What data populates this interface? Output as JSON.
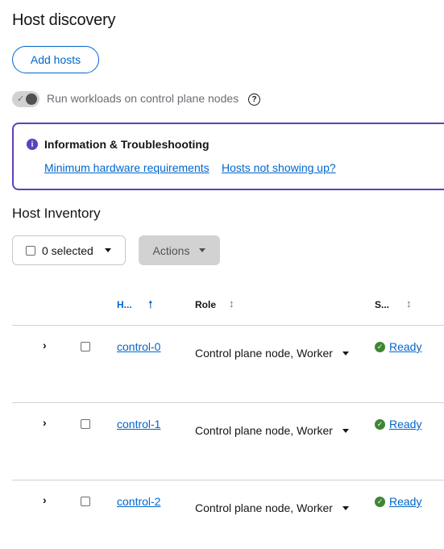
{
  "page": {
    "title": "Host discovery"
  },
  "toolbar": {
    "add_hosts_label": "Add hosts"
  },
  "workloads_toggle": {
    "label": "Run workloads on control plane nodes",
    "help_glyph": "?",
    "check_glyph": "✓"
  },
  "alert": {
    "icon_glyph": "i",
    "title": "Information & Troubleshooting",
    "links": [
      "Minimum hardware requirements",
      "Hosts not showing up?"
    ]
  },
  "inventory": {
    "title": "Host Inventory",
    "bulk_select_label": "0 selected",
    "actions_label": "Actions",
    "columns": {
      "hostname": "H...",
      "role": "Role",
      "status": "S..."
    },
    "sort_glyphs": {
      "active": "🠕",
      "inactive": "↕"
    },
    "rows": [
      {
        "hostname": "control-0",
        "role": "Control plane node, Worker",
        "status": "Ready"
      },
      {
        "hostname": "control-1",
        "role": "Control plane node, Worker",
        "status": "Ready"
      },
      {
        "hostname": "control-2",
        "role": "Control plane node, Worker",
        "status": "Ready"
      }
    ]
  },
  "glyphs": {
    "chevron_right": "›",
    "check": "✓"
  },
  "colors": {
    "link": "#0066cc",
    "alert_border": "#5e40be",
    "success": "#3e8635"
  }
}
